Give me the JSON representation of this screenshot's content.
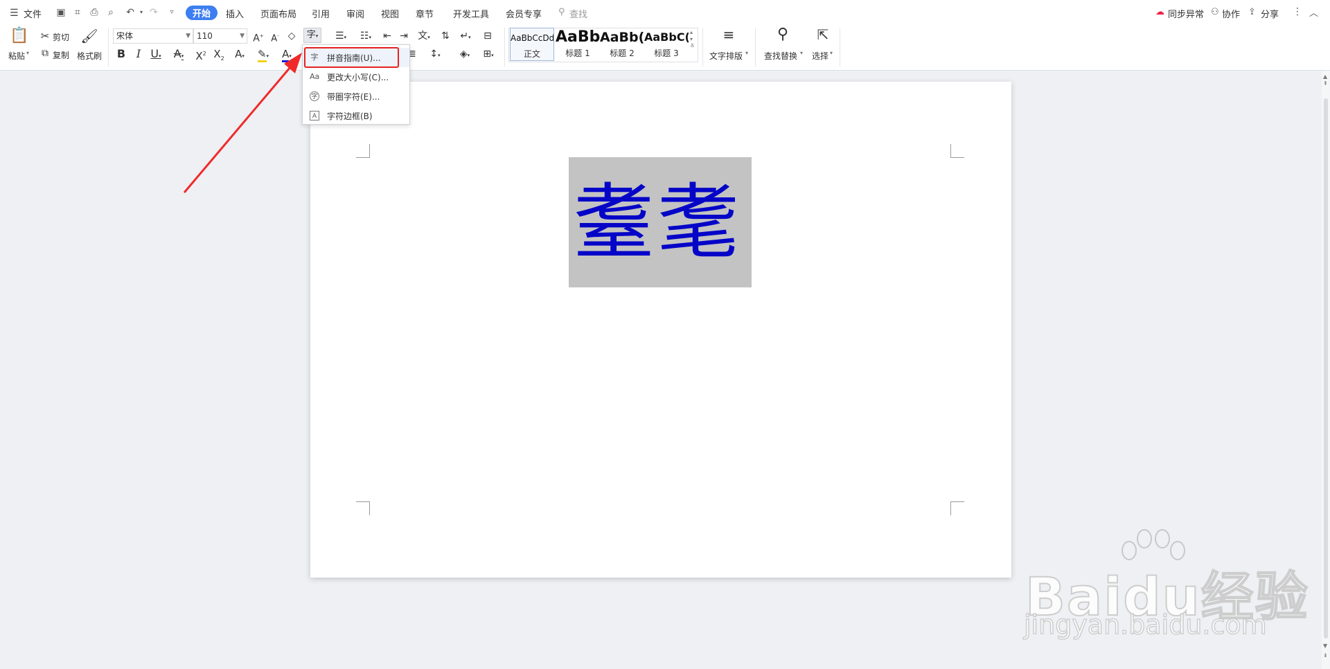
{
  "menu": {
    "file": "文件",
    "tabs": [
      "开始",
      "插入",
      "页面布局",
      "引用",
      "审阅",
      "视图",
      "章节",
      "开发工具",
      "会员专享"
    ],
    "search": "查找"
  },
  "right": {
    "sync": "同步异常",
    "collab": "协作",
    "share": "分享"
  },
  "ribbon": {
    "paste": "粘贴",
    "cut": "剪切",
    "copy": "复制",
    "format_painter": "格式刷",
    "font_name": "宋体",
    "font_size": "110",
    "styles": [
      {
        "sample": "AaBbCcDd",
        "name": "正文"
      },
      {
        "sample": "AaBb",
        "name": "标题 1"
      },
      {
        "sample": "AaBb(",
        "name": "标题 2"
      },
      {
        "sample": "AaBbC(",
        "name": "标题 3"
      }
    ],
    "text_layout": "文字排版",
    "find_replace": "查找替换",
    "select": "选择"
  },
  "dropdown": {
    "items": [
      {
        "icon": "pinyin-icon",
        "label": "拼音指南(U)..."
      },
      {
        "icon": "change-case-icon",
        "label": "更改大小写(C)..."
      },
      {
        "icon": "enclose-char-icon",
        "label": "带圈字符(E)..."
      },
      {
        "icon": "char-border-icon",
        "label": "字符边框(B)"
      }
    ]
  },
  "document": {
    "text": "耋耄"
  },
  "watermark": {
    "brand": "Baidu经验",
    "url": "jingyan.baidu.com"
  },
  "colors": {
    "accent": "#3d7ef0",
    "highlight_red": "#e62121",
    "doc_text_blue": "#0505c8",
    "textbox_gray": "#c3c3c3"
  }
}
